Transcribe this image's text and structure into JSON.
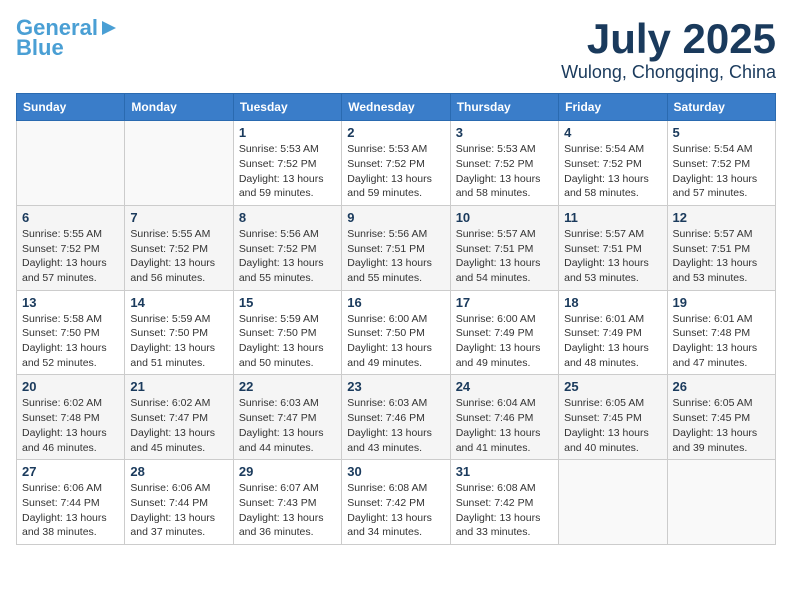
{
  "header": {
    "logo_line1": "General",
    "logo_line2": "Blue",
    "month": "July 2025",
    "location": "Wulong, Chongqing, China"
  },
  "weekdays": [
    "Sunday",
    "Monday",
    "Tuesday",
    "Wednesday",
    "Thursday",
    "Friday",
    "Saturday"
  ],
  "weeks": [
    [
      {
        "day": "",
        "info": ""
      },
      {
        "day": "",
        "info": ""
      },
      {
        "day": "1",
        "info": "Sunrise: 5:53 AM\nSunset: 7:52 PM\nDaylight: 13 hours\nand 59 minutes."
      },
      {
        "day": "2",
        "info": "Sunrise: 5:53 AM\nSunset: 7:52 PM\nDaylight: 13 hours\nand 59 minutes."
      },
      {
        "day": "3",
        "info": "Sunrise: 5:53 AM\nSunset: 7:52 PM\nDaylight: 13 hours\nand 58 minutes."
      },
      {
        "day": "4",
        "info": "Sunrise: 5:54 AM\nSunset: 7:52 PM\nDaylight: 13 hours\nand 58 minutes."
      },
      {
        "day": "5",
        "info": "Sunrise: 5:54 AM\nSunset: 7:52 PM\nDaylight: 13 hours\nand 57 minutes."
      }
    ],
    [
      {
        "day": "6",
        "info": "Sunrise: 5:55 AM\nSunset: 7:52 PM\nDaylight: 13 hours\nand 57 minutes."
      },
      {
        "day": "7",
        "info": "Sunrise: 5:55 AM\nSunset: 7:52 PM\nDaylight: 13 hours\nand 56 minutes."
      },
      {
        "day": "8",
        "info": "Sunrise: 5:56 AM\nSunset: 7:52 PM\nDaylight: 13 hours\nand 55 minutes."
      },
      {
        "day": "9",
        "info": "Sunrise: 5:56 AM\nSunset: 7:51 PM\nDaylight: 13 hours\nand 55 minutes."
      },
      {
        "day": "10",
        "info": "Sunrise: 5:57 AM\nSunset: 7:51 PM\nDaylight: 13 hours\nand 54 minutes."
      },
      {
        "day": "11",
        "info": "Sunrise: 5:57 AM\nSunset: 7:51 PM\nDaylight: 13 hours\nand 53 minutes."
      },
      {
        "day": "12",
        "info": "Sunrise: 5:57 AM\nSunset: 7:51 PM\nDaylight: 13 hours\nand 53 minutes."
      }
    ],
    [
      {
        "day": "13",
        "info": "Sunrise: 5:58 AM\nSunset: 7:50 PM\nDaylight: 13 hours\nand 52 minutes."
      },
      {
        "day": "14",
        "info": "Sunrise: 5:59 AM\nSunset: 7:50 PM\nDaylight: 13 hours\nand 51 minutes."
      },
      {
        "day": "15",
        "info": "Sunrise: 5:59 AM\nSunset: 7:50 PM\nDaylight: 13 hours\nand 50 minutes."
      },
      {
        "day": "16",
        "info": "Sunrise: 6:00 AM\nSunset: 7:50 PM\nDaylight: 13 hours\nand 49 minutes."
      },
      {
        "day": "17",
        "info": "Sunrise: 6:00 AM\nSunset: 7:49 PM\nDaylight: 13 hours\nand 49 minutes."
      },
      {
        "day": "18",
        "info": "Sunrise: 6:01 AM\nSunset: 7:49 PM\nDaylight: 13 hours\nand 48 minutes."
      },
      {
        "day": "19",
        "info": "Sunrise: 6:01 AM\nSunset: 7:48 PM\nDaylight: 13 hours\nand 47 minutes."
      }
    ],
    [
      {
        "day": "20",
        "info": "Sunrise: 6:02 AM\nSunset: 7:48 PM\nDaylight: 13 hours\nand 46 minutes."
      },
      {
        "day": "21",
        "info": "Sunrise: 6:02 AM\nSunset: 7:47 PM\nDaylight: 13 hours\nand 45 minutes."
      },
      {
        "day": "22",
        "info": "Sunrise: 6:03 AM\nSunset: 7:47 PM\nDaylight: 13 hours\nand 44 minutes."
      },
      {
        "day": "23",
        "info": "Sunrise: 6:03 AM\nSunset: 7:46 PM\nDaylight: 13 hours\nand 43 minutes."
      },
      {
        "day": "24",
        "info": "Sunrise: 6:04 AM\nSunset: 7:46 PM\nDaylight: 13 hours\nand 41 minutes."
      },
      {
        "day": "25",
        "info": "Sunrise: 6:05 AM\nSunset: 7:45 PM\nDaylight: 13 hours\nand 40 minutes."
      },
      {
        "day": "26",
        "info": "Sunrise: 6:05 AM\nSunset: 7:45 PM\nDaylight: 13 hours\nand 39 minutes."
      }
    ],
    [
      {
        "day": "27",
        "info": "Sunrise: 6:06 AM\nSunset: 7:44 PM\nDaylight: 13 hours\nand 38 minutes."
      },
      {
        "day": "28",
        "info": "Sunrise: 6:06 AM\nSunset: 7:44 PM\nDaylight: 13 hours\nand 37 minutes."
      },
      {
        "day": "29",
        "info": "Sunrise: 6:07 AM\nSunset: 7:43 PM\nDaylight: 13 hours\nand 36 minutes."
      },
      {
        "day": "30",
        "info": "Sunrise: 6:08 AM\nSunset: 7:42 PM\nDaylight: 13 hours\nand 34 minutes."
      },
      {
        "day": "31",
        "info": "Sunrise: 6:08 AM\nSunset: 7:42 PM\nDaylight: 13 hours\nand 33 minutes."
      },
      {
        "day": "",
        "info": ""
      },
      {
        "day": "",
        "info": ""
      }
    ]
  ]
}
